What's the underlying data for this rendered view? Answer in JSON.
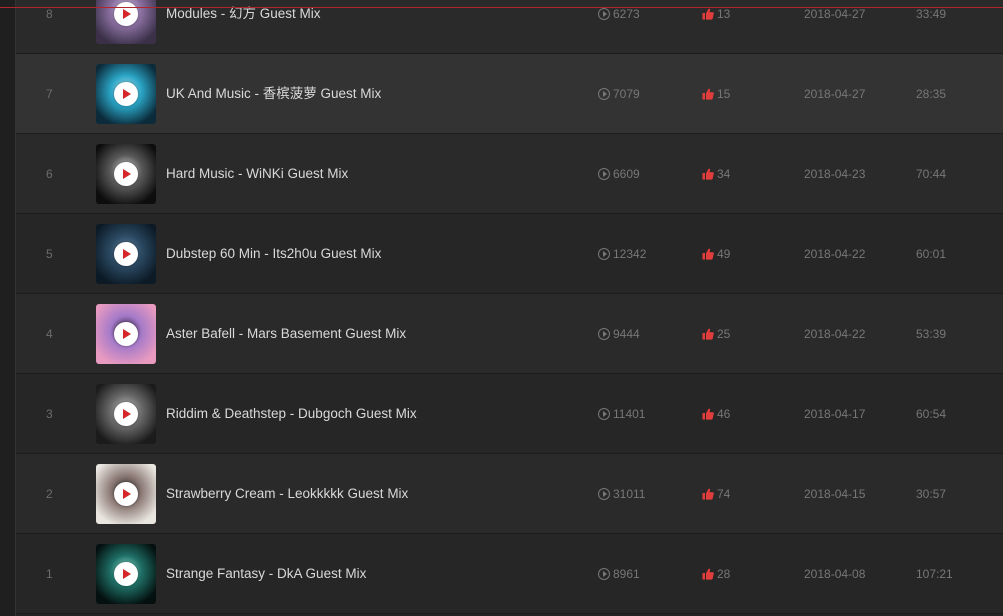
{
  "tracks": [
    {
      "index": "8",
      "title": "Modules - 幻方 Guest Mix",
      "plays": "6273",
      "likes": "13",
      "date": "2018-04-27",
      "duration": "33:49",
      "art_colors": [
        "#3a3048",
        "#8a6fa0",
        "#e0d7ee"
      ]
    },
    {
      "index": "7",
      "title": "UK And Music - 香槟菠萝 Guest Mix",
      "plays": "7079",
      "likes": "15",
      "date": "2018-04-27",
      "duration": "28:35",
      "art_colors": [
        "#0b2a3a",
        "#2aa4c4",
        "#bff0ff"
      ]
    },
    {
      "index": "6",
      "title": "Hard Music - WiNKi Guest Mix",
      "plays": "6609",
      "likes": "34",
      "date": "2018-04-23",
      "duration": "70:44",
      "art_colors": [
        "#0d0d0d",
        "#5a5a5a",
        "#e8e8e8"
      ]
    },
    {
      "index": "5",
      "title": "Dubstep 60 Min - Its2h0u Guest Mix",
      "plays": "12342",
      "likes": "49",
      "date": "2018-04-22",
      "duration": "60:01",
      "art_colors": [
        "#0c1a26",
        "#2b4a63",
        "#6d8aa3"
      ]
    },
    {
      "index": "4",
      "title": "Aster Bafell - Mars Basement Guest Mix",
      "plays": "9444",
      "likes": "25",
      "date": "2018-04-22",
      "duration": "53:39",
      "art_colors": [
        "#e89ac0",
        "#a57ac9",
        "#2b1f33"
      ]
    },
    {
      "index": "3",
      "title": "Riddim & Deathstep - Dubgoch Guest Mix",
      "plays": "11401",
      "likes": "46",
      "date": "2018-04-17",
      "duration": "60:54",
      "art_colors": [
        "#1b1b1b",
        "#6b6b6b",
        "#cfcfcf"
      ]
    },
    {
      "index": "2",
      "title": "Strawberry Cream - Leokkkkk Guest Mix",
      "plays": "31011",
      "likes": "74",
      "date": "2018-04-15",
      "duration": "30:57",
      "art_colors": [
        "#e9e6df",
        "#8c7a76",
        "#2a2a2a"
      ]
    },
    {
      "index": "1",
      "title": "Strange Fantasy - DkA Guest Mix",
      "plays": "8961",
      "likes": "28",
      "date": "2018-04-08",
      "duration": "107:21",
      "art_colors": [
        "#04100f",
        "#1f6f66",
        "#9ff2e2"
      ]
    }
  ],
  "hover_index": 1,
  "colors": {
    "accent": "#d5262b",
    "like": "#e23d3d",
    "bg": "#242424"
  },
  "icons": {
    "play_count": "play-circle-icon",
    "likes": "thumbs-up-icon",
    "thumb_play": "play-button-icon"
  }
}
